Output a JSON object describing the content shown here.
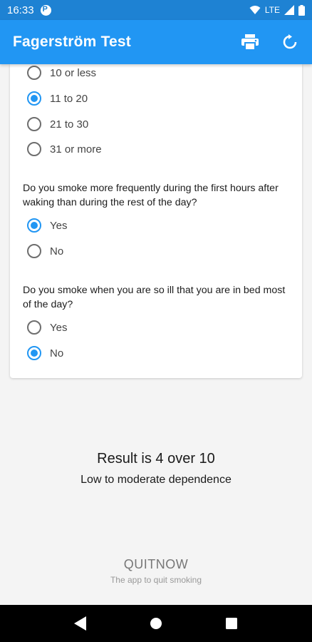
{
  "status_bar": {
    "time": "16:33",
    "network": "LTE"
  },
  "app_bar": {
    "title": "Fagerström Test",
    "print_icon": "print-icon",
    "reset_icon": "refresh-icon"
  },
  "questions": [
    {
      "question": "",
      "options": [
        {
          "label": "10 or less",
          "checked": false
        },
        {
          "label": "11 to 20",
          "checked": true
        },
        {
          "label": "21 to 30",
          "checked": false
        },
        {
          "label": "31 or more",
          "checked": false
        }
      ]
    },
    {
      "question": "Do you smoke more frequently during the first hours after waking than during the rest of the day?",
      "options": [
        {
          "label": "Yes",
          "checked": true
        },
        {
          "label": "No",
          "checked": false
        }
      ]
    },
    {
      "question": "Do you smoke when you are so ill that you are in bed most of the day?",
      "options": [
        {
          "label": "Yes",
          "checked": false
        },
        {
          "label": "No",
          "checked": true
        }
      ]
    }
  ],
  "result": {
    "title": "Result is 4 over 10",
    "description": "Low to moderate dependence"
  },
  "footer": {
    "brand_bold": "QUIT",
    "brand_light": "NOW",
    "tagline": "The app to quit smoking"
  },
  "colors": {
    "primary": "#2196f3",
    "status_bar": "#1e82d3"
  }
}
